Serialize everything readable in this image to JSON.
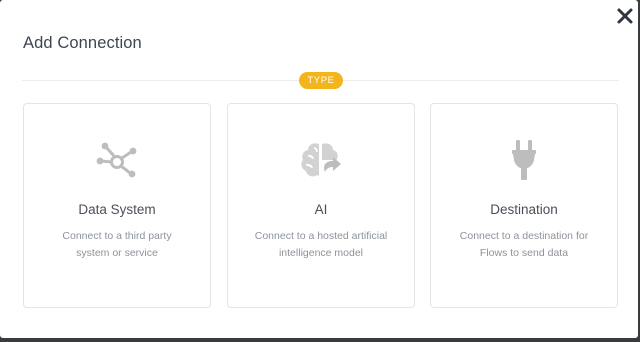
{
  "modal": {
    "title": "Add Connection",
    "type_label": "TYPE"
  },
  "cards": [
    {
      "title": "Data System",
      "desc_line1": "Connect to a third party",
      "desc_line2": "system or service",
      "icon": "data-system-network-icon"
    },
    {
      "title": "AI",
      "desc_line1": "Connect to a hosted artificial",
      "desc_line2": "intelligence model",
      "icon": "ai-brain-icon"
    },
    {
      "title": "Destination",
      "desc_line1": "Connect to a destination for",
      "desc_line2": "Flows to send data",
      "icon": "plug-icon"
    }
  ],
  "colors": {
    "accent": "#f4b51c",
    "icon_gray": "#bdbdbd",
    "title_text": "#3f4652"
  }
}
